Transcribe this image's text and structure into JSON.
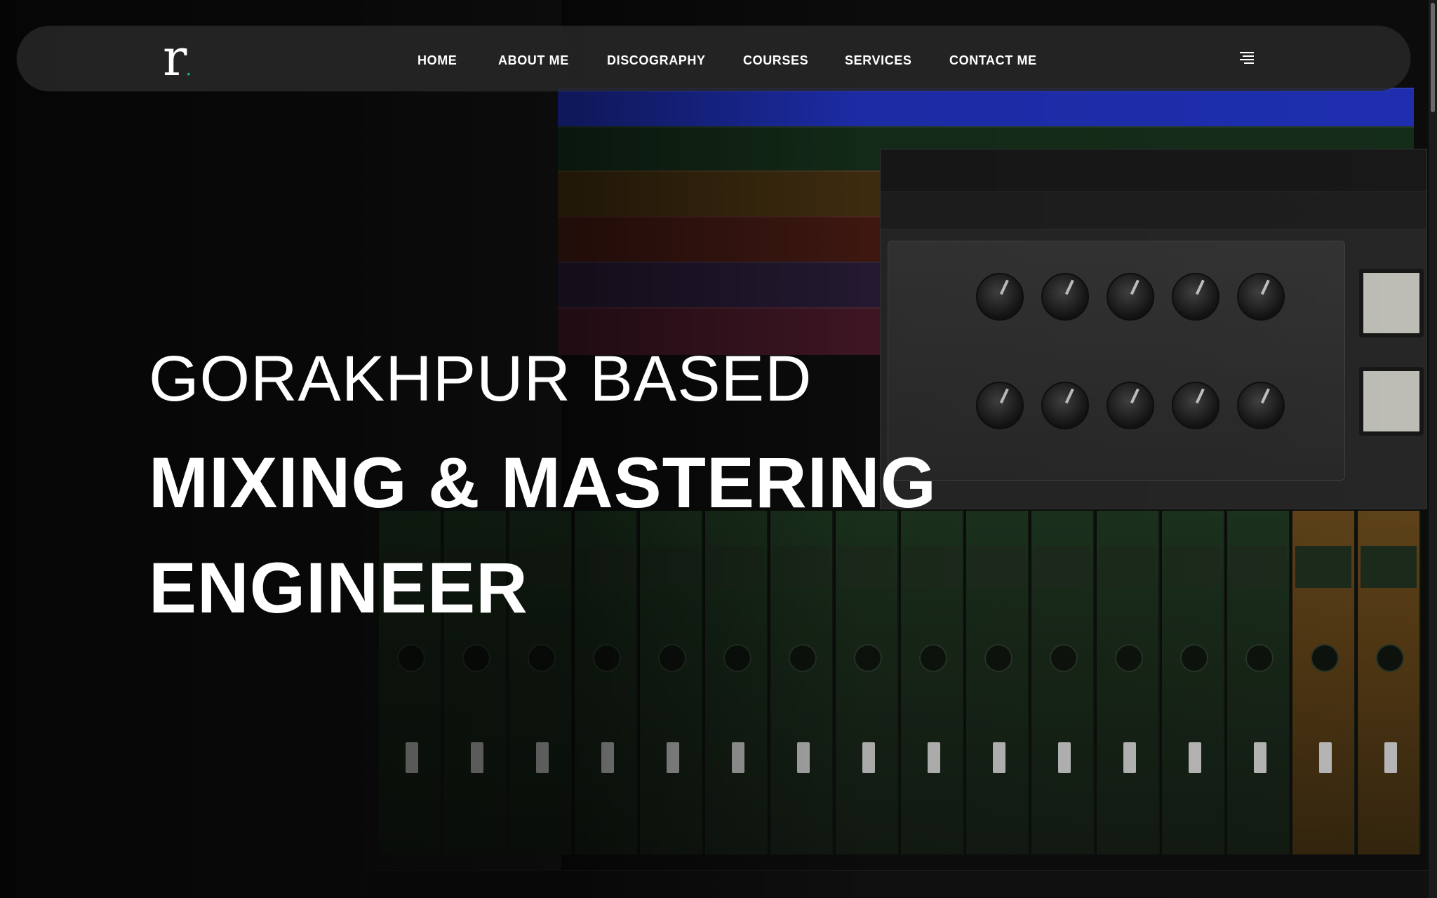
{
  "brand": {
    "logo_letter": "r",
    "logo_dot": ".",
    "accent": "#1db97a"
  },
  "nav": {
    "items": [
      {
        "label": "HOME"
      },
      {
        "label": "ABOUT ME"
      },
      {
        "label": "DISCOGRAPHY"
      },
      {
        "label": "COURSES"
      },
      {
        "label": "SERVICES"
      },
      {
        "label": "CONTACT ME"
      }
    ],
    "menu_icon": "hamburger-menu-icon"
  },
  "hero": {
    "line1": "GORAKHPUR BASED",
    "line2": "MIXING & MASTERING",
    "line3": "ENGINEER"
  }
}
